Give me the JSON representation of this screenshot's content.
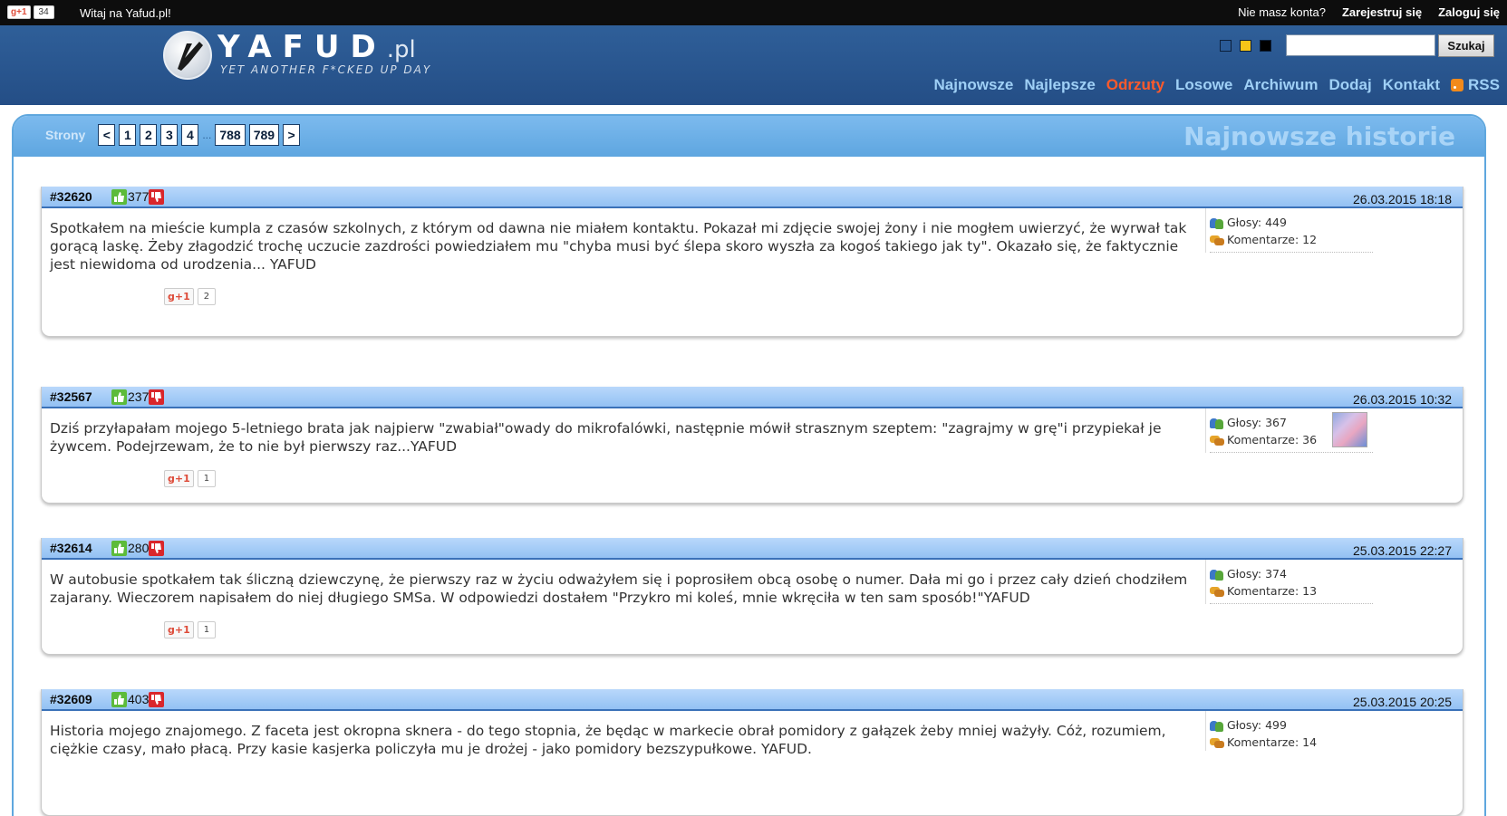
{
  "topbar": {
    "gplus_label": "g+1",
    "gplus_count": "34",
    "welcome": "Witaj na Yafud.pl!",
    "no_account": "Nie masz konta?",
    "register": "Zarejestruj się",
    "login": "Zaloguj się"
  },
  "header": {
    "logo_main": "YAFUD",
    "logo_pl": ".pl",
    "logo_sub": "YET ANOTHER F*CKED UP DAY",
    "search_button": "Szukaj",
    "search_value": "",
    "swatches": [
      "#2a5a96",
      "#f5c518",
      "#000000"
    ],
    "nav": [
      "Najnowsze",
      "Najlepsze",
      "Odrzuty",
      "Losowe",
      "Archiwum",
      "Dodaj",
      "Kontakt"
    ],
    "rss": "RSS",
    "active_nav": "Odrzuty",
    "active_color": "#ff5a2a"
  },
  "pager": {
    "label": "Strony",
    "prev": "<",
    "pages": [
      "1",
      "2",
      "3",
      "4"
    ],
    "dots": "...",
    "last_pages": [
      "788",
      "789"
    ],
    "next": ">"
  },
  "section_title": "Najnowsze historie",
  "stories": [
    {
      "id": "#32620",
      "score": "377",
      "date": "26.03.2015 18:18",
      "text": "Spotkałem na mieście kumpla z czasów szkolnych, z którym od dawna nie miałem kontaktu. Pokazał mi zdjęcie swojej żony i nie mogłem uwierzyć, że wyrwał tak gorącą laskę. Żeby złagodzić trochę uczucie zazdrości powiedziałem mu \"chyba musi być ślepa skoro wyszła za kogoś takiego jak ty\". Okazało się, że faktycznie jest niewidoma od urodzenia... YAFUD",
      "gplus": "g+1",
      "gplus_count": "2",
      "votes": "Głosy: 449",
      "comments": "Komentarze: 12"
    },
    {
      "id": "#32567",
      "score": "237",
      "date": "26.03.2015 10:32",
      "text": "Dziś przyłapałam mojego 5-letniego brata jak najpierw \"zwabiał\"owady do mikrofalówki, następnie mówił strasznym szeptem: \"zagrajmy w grę\"i przypiekał je żywcem. Podejrzewam, że to nie był pierwszy raz...YAFUD",
      "gplus": "g+1",
      "gplus_count": "1",
      "votes": "Głosy: 367",
      "comments": "Komentarze: 36"
    },
    {
      "id": "#32614",
      "score": "280",
      "date": "25.03.2015 22:27",
      "text": "W autobusie spotkałem tak śliczną dziewczynę, że pierwszy raz w życiu odważyłem się i poprosiłem obcą osobę o numer. Dała mi go i przez cały dzień chodziłem zajarany. Wieczorem napisałem do niej długiego SMSa. W odpowiedzi dostałem \"Przykro mi koleś, mnie wkręciła w ten sam sposób!\"YAFUD",
      "gplus": "g+1",
      "gplus_count": "1",
      "votes": "Głosy: 374",
      "comments": "Komentarze: 13"
    },
    {
      "id": "#32609",
      "score": "403",
      "date": "25.03.2015 20:25",
      "text": "Historia mojego znajomego. Z faceta jest okropna sknera - do tego stopnia, że będąc w markecie obrał pomidory z gałązek żeby mniej ważyły. Cóż, rozumiem, ciężkie czasy, mało płacą. Przy kasie kasjerka policzyła mu je drożej - jako pomidory bezszypułkowe. YAFUD.",
      "votes": "Głosy: 499",
      "comments": "Komentarze: 14"
    }
  ]
}
